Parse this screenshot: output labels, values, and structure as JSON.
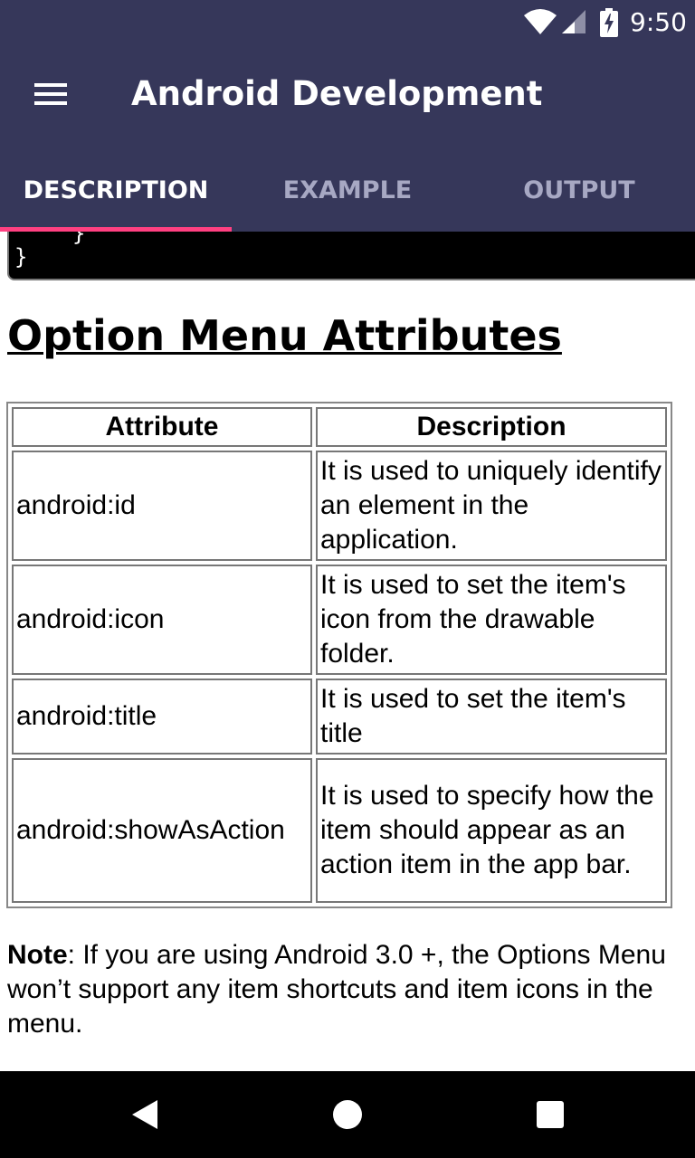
{
  "status_bar": {
    "time": "9:50",
    "icons": [
      "wifi-icon",
      "signal-icon",
      "battery-charging-icon"
    ]
  },
  "app_bar": {
    "title": "Android Development",
    "menu_icon": "hamburger-menu-icon"
  },
  "tabs": [
    {
      "label": "DESCRIPTION",
      "active": true
    },
    {
      "label": "EXAMPLE",
      "active": false
    },
    {
      "label": "OUTPUT",
      "active": false
    }
  ],
  "colors": {
    "primary": "#36375a",
    "accent": "#ff4081",
    "tab_inactive": "#a7a8c3"
  },
  "code_block": {
    "line1": "}",
    "line2": "}"
  },
  "section": {
    "heading": "Option Menu Attributes"
  },
  "table": {
    "headers": [
      "Attribute",
      "Description"
    ],
    "rows": [
      {
        "attribute": "android:id",
        "description": "It is used to uniquely identify an element in the application."
      },
      {
        "attribute": "android:icon",
        "description": "It is used to set the item's icon from the drawable folder."
      },
      {
        "attribute": "android:title",
        "description": "It is used to set the item's title"
      },
      {
        "attribute": "android:showAsAction",
        "description": "It is used to specify how the item should appear as an action item in the app bar."
      }
    ]
  },
  "note": {
    "label": "Note",
    "text": ": If you are using Android 3.0 +, the Options Menu won’t support any item shortcuts and item icons in the menu."
  },
  "nav_bar": {
    "icons": [
      "back-icon",
      "home-icon",
      "recents-icon"
    ]
  }
}
